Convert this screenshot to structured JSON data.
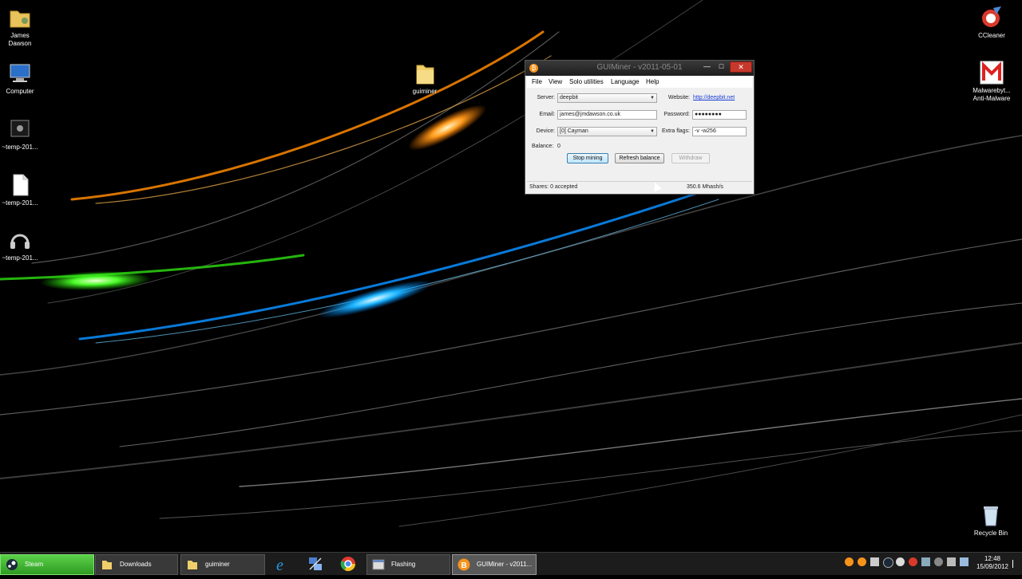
{
  "desktop": {
    "icons_left": [
      {
        "label": "James\nDawson",
        "icon": "user-folder-icon"
      },
      {
        "label": "Computer",
        "icon": "computer-icon"
      },
      {
        "label": "~temp-201...",
        "icon": "video-file-icon"
      },
      {
        "label": "~temp-201...",
        "icon": "document-file-icon"
      },
      {
        "label": "~temp-201...",
        "icon": "audio-file-icon"
      }
    ],
    "folder_guiminer": {
      "label": "guiminer",
      "icon": "folder-icon"
    },
    "icons_right": [
      {
        "label": "CCleaner",
        "icon": "ccleaner-icon"
      },
      {
        "label": "Malwarebyt...\nAnti-Malware",
        "icon": "malwarebytes-icon"
      },
      {
        "label": "Recycle Bin",
        "icon": "recycle-bin-icon"
      }
    ]
  },
  "window": {
    "title": "GUIMiner - v2011-05-01",
    "minimize_glyph": "—",
    "maximize_glyph": "□",
    "close_glyph": "✕",
    "menu": [
      "File",
      "View",
      "Solo utilities",
      "Language",
      "Help"
    ],
    "server_label": "Server:",
    "server_value": "deepbit",
    "website_label": "Website:",
    "website_link": "http://deepbit.net",
    "email_label": "Email:",
    "email_value": "james@jmdawson.co.uk",
    "password_label": "Password:",
    "password_value": "●●●●●●●●",
    "device_label": "Device:",
    "device_value": "[0] Cayman",
    "extra_flags_label": "Extra flags:",
    "extra_flags_value": "-v -w256",
    "balance_label": "Balance:",
    "balance_value": "0",
    "buttons": {
      "stop": "Stop mining",
      "refresh": "Refresh balance",
      "withdraw": "Withdraw"
    },
    "status_shares": "Shares: 0 accepted",
    "status_rate": "350.6 Mhash/s"
  },
  "taskbar": {
    "tasks": [
      {
        "label": "Steam",
        "icon": "steam-icon"
      },
      {
        "label": "Downloads",
        "icon": "folder-icon"
      },
      {
        "label": "guiminer",
        "icon": "folder-icon"
      },
      {
        "label": "Flashing",
        "icon": "window-icon"
      },
      {
        "label": "GUIMiner - v2011...",
        "icon": "bitcoin-icon"
      }
    ],
    "pinned": [
      "internet-explorer-icon",
      "network-tool-icon",
      "chrome-icon"
    ],
    "clock_time": "12:48",
    "clock_date": "15/09/2012"
  },
  "colors": {
    "accent_bitcoin": "#f7931a",
    "steam_green": "#3fb52f",
    "close_red": "#c7382c",
    "link_blue": "#1a3fd6"
  }
}
